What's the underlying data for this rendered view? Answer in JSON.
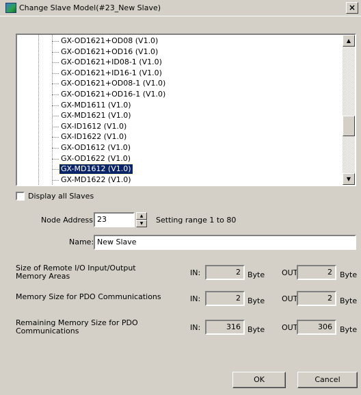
{
  "window": {
    "title": "Change Slave Model(#23_New Slave)",
    "close_glyph": "×"
  },
  "tree": {
    "items": [
      "GX-OD1621+OD08 (V1.0)",
      "GX-OD1621+OD16 (V1.0)",
      "GX-OD1621+ID08-1 (V1.0)",
      "GX-OD1621+ID16-1 (V1.0)",
      "GX-OD1621+OD08-1 (V1.0)",
      "GX-OD1621+OD16-1 (V1.0)",
      "GX-MD1611 (V1.0)",
      "GX-MD1621 (V1.0)",
      "GX-ID1612 (V1.0)",
      "GX-ID1622 (V1.0)",
      "GX-OD1612 (V1.0)",
      "GX-OD1622 (V1.0)",
      "GX-MD1612 (V1.0)",
      "GX-MD1622 (V1.0)"
    ],
    "selected_index": 12
  },
  "display_all_slaves": {
    "label": "Display all Slaves",
    "checked": false
  },
  "node_address": {
    "label": "Node Address:",
    "value": "23",
    "range_text": "Setting range 1 to 80"
  },
  "name": {
    "label": "Name:",
    "value": "New Slave"
  },
  "memory": {
    "rows": [
      {
        "label_line1": "Size of Remote I/O Input/Output",
        "label_line2": "Memory Areas",
        "in_label": "IN:",
        "in_value": "2",
        "in_unit": "Byte",
        "out_label": "OUT:",
        "out_value": "2",
        "out_unit": "Byte"
      },
      {
        "label_line1": "Memory Size for PDO Communications",
        "label_line2": "",
        "in_label": "IN:",
        "in_value": "2",
        "in_unit": "Byte",
        "out_label": "OUT:",
        "out_value": "2",
        "out_unit": "Byte"
      },
      {
        "label_line1": "Remaining Memory Size for PDO",
        "label_line2": "Communications",
        "in_label": "IN:",
        "in_value": "316",
        "in_unit": "Byte",
        "out_label": "OUT:",
        "out_value": "306",
        "out_unit": "Byte"
      }
    ]
  },
  "buttons": {
    "ok": "OK",
    "cancel": "Cancel"
  }
}
